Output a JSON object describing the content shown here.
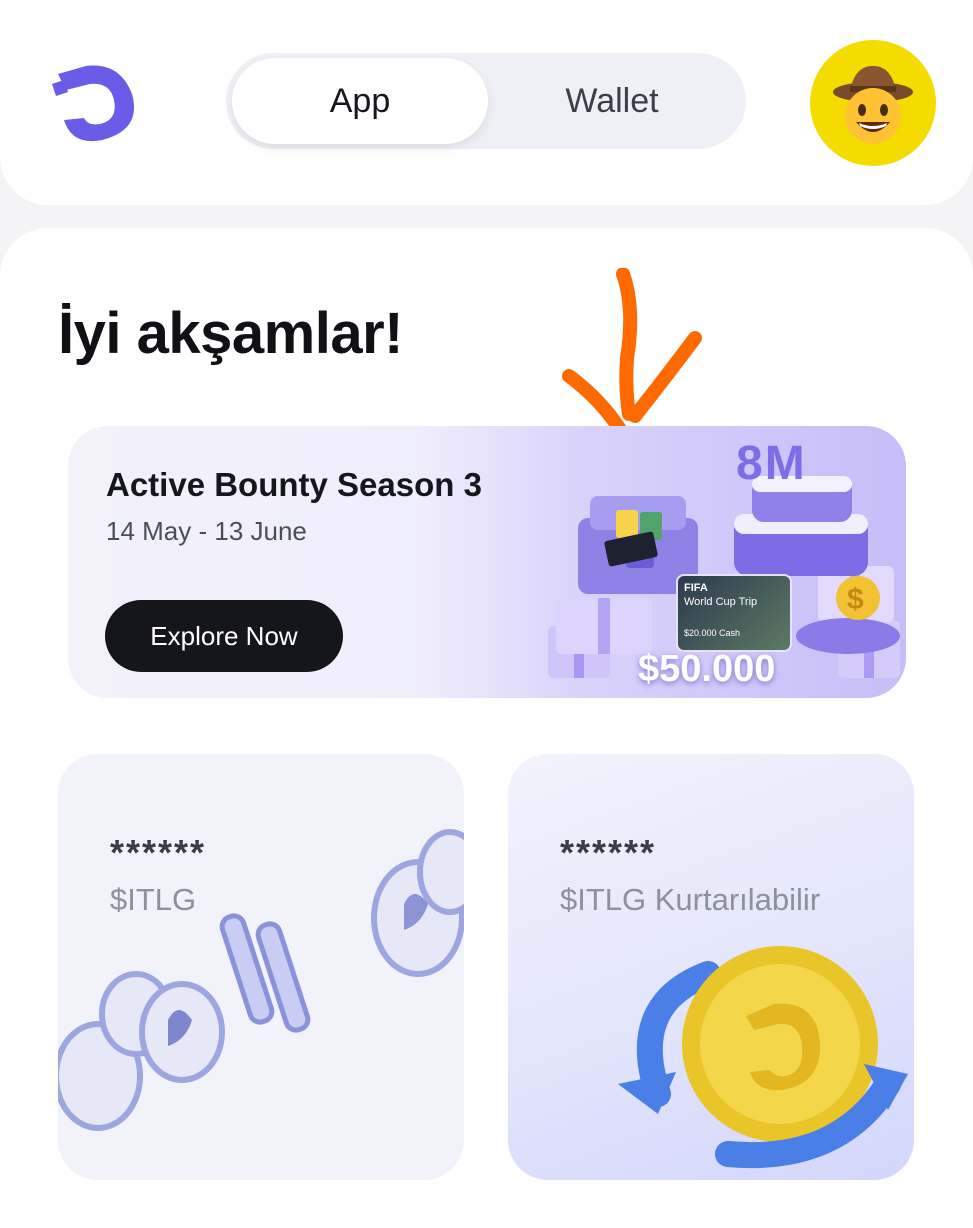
{
  "header": {
    "logo_icon": "app-logo-icon",
    "tabs": [
      {
        "label": "App",
        "active": true
      },
      {
        "label": "Wallet",
        "active": false
      }
    ],
    "avatar_icon": "cowboy-emoji-avatar",
    "avatar_bg": "#f5dc00"
  },
  "main": {
    "greeting": "İyi akşamlar!"
  },
  "annotation": {
    "icon": "orange-hand-drawn-arrow-icon",
    "color": "#ff6a00"
  },
  "banner": {
    "title": "Active Bounty Season 3",
    "dates": "14 May - 13 June",
    "button_label": "Explore Now",
    "art": {
      "headline": "8M",
      "ticket_title": "FIFA",
      "ticket_subtitle": "World Cup Trip",
      "ticket_cash": "$20.000 Cash",
      "prize": "$50.000"
    }
  },
  "cards": [
    {
      "amount": "******",
      "label": "$ITLG",
      "art_icon": "silver-coins-icon"
    },
    {
      "amount": "******",
      "label": "$ITLG Kurtarılabilir",
      "art_icon": "gold-coin-refresh-icon"
    }
  ],
  "colors": {
    "accent": "#6b5ce7",
    "button_dark": "#14161c"
  }
}
